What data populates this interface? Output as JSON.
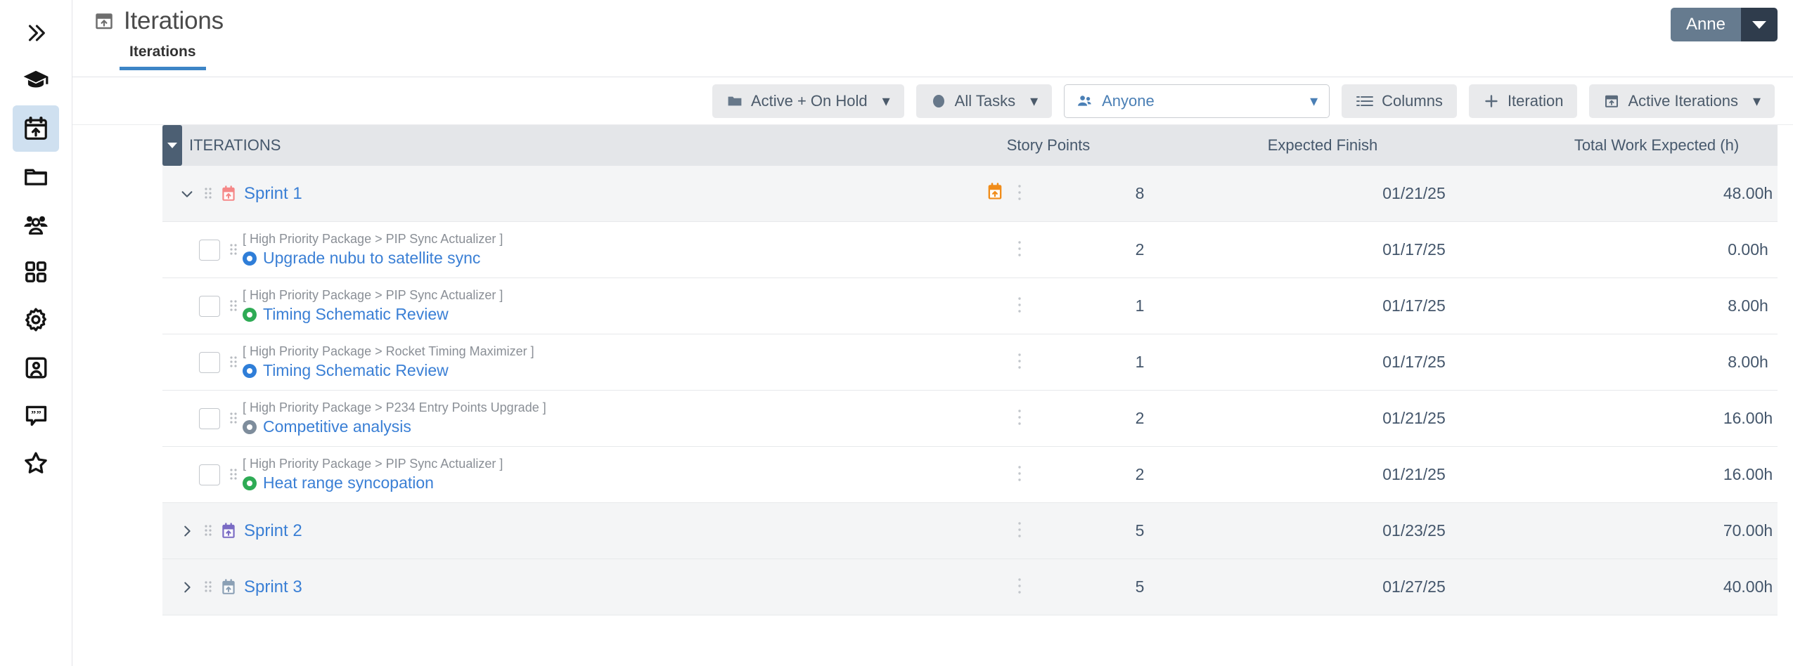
{
  "header": {
    "title": "Iterations",
    "title_icon": "calendar-upload-icon",
    "tabs": [
      {
        "label": "Iterations",
        "active": true
      }
    ],
    "user": {
      "name": "Anne",
      "caret_icon": "caret-down-icon"
    }
  },
  "sidebar": {
    "collapse_icon": "chevrons-right-icon",
    "items": [
      {
        "name": "graduation-cap",
        "icon": "graduation-cap-icon",
        "active": false
      },
      {
        "name": "iterations",
        "icon": "calendar-upload-icon",
        "active": true
      },
      {
        "name": "folder",
        "icon": "folder-icon",
        "active": false
      },
      {
        "name": "people",
        "icon": "people-group-icon",
        "active": false
      },
      {
        "name": "grid",
        "icon": "grid-squares-icon",
        "active": false
      },
      {
        "name": "settings",
        "icon": "gear-icon",
        "active": false
      },
      {
        "name": "contact",
        "icon": "contact-card-icon",
        "active": false
      },
      {
        "name": "feedback",
        "icon": "quote-bubble-icon",
        "active": false
      },
      {
        "name": "favorites",
        "icon": "star-icon",
        "active": false
      }
    ]
  },
  "toolbar": {
    "status_filter": {
      "label": "Active + On Hold",
      "icon": "folder-icon",
      "caret": "▾"
    },
    "task_filter": {
      "label": "All Tasks",
      "icon": "circle-icon",
      "caret": "▾"
    },
    "assignee_filter": {
      "label": "Anyone",
      "icon": "people-icon",
      "caret": "▾"
    },
    "columns_button": {
      "label": "Columns",
      "icon": "columns-list-icon"
    },
    "add_iteration_button": {
      "label": "Iteration",
      "icon": "plus-icon"
    },
    "view_selector": {
      "label": "Active Iterations",
      "icon": "calendar-upload-icon",
      "caret": "▾"
    }
  },
  "table": {
    "columns": {
      "name": "ITERATIONS",
      "story_points": "Story Points",
      "expected_finish": "Expected Finish",
      "total_work": "Total Work Expected (h)"
    },
    "rows": [
      {
        "type": "sprint",
        "name": "Sprint 1",
        "expanded": true,
        "icon_color": "#f58787",
        "mid_icon": "calendar-upload-icon",
        "mid_icon_color": "#f08c1a",
        "story_points": "8",
        "expected_finish": "01/21/25",
        "total_work": "48.00h"
      },
      {
        "type": "task",
        "breadcrumb": "[ High Priority Package > PIP Sync Actualizer ]",
        "name": "Upgrade nubu to satellite sync",
        "status_color": "#2f7ed8",
        "story_points": "2",
        "expected_finish": "01/17/25",
        "total_work": "0.00h"
      },
      {
        "type": "task",
        "breadcrumb": "[ High Priority Package > PIP Sync Actualizer ]",
        "name": "Timing Schematic Review",
        "status_color": "#2eab55",
        "story_points": "1",
        "expected_finish": "01/17/25",
        "total_work": "8.00h"
      },
      {
        "type": "task",
        "breadcrumb": "[ High Priority Package > Rocket Timing Maximizer ]",
        "name": "Timing Schematic Review",
        "status_color": "#2f7ed8",
        "story_points": "1",
        "expected_finish": "01/17/25",
        "total_work": "8.00h"
      },
      {
        "type": "task",
        "breadcrumb": "[ High Priority Package > P234 Entry Points Upgrade ]",
        "name": "Competitive analysis",
        "status_color": "#7e8d9c",
        "story_points": "2",
        "expected_finish": "01/21/25",
        "total_work": "16.00h"
      },
      {
        "type": "task",
        "breadcrumb": "[ High Priority Package > PIP Sync Actualizer ]",
        "name": "Heat range syncopation",
        "status_color": "#2eab55",
        "story_points": "2",
        "expected_finish": "01/21/25",
        "total_work": "16.00h"
      },
      {
        "type": "sprint",
        "name": "Sprint 2",
        "expanded": false,
        "icon_color": "#7a6bc4",
        "story_points": "5",
        "expected_finish": "01/23/25",
        "total_work": "70.00h"
      },
      {
        "type": "sprint",
        "name": "Sprint 3",
        "expanded": false,
        "icon_color": "#8ba0b5",
        "story_points": "5",
        "expected_finish": "01/27/25",
        "total_work": "40.00h"
      }
    ]
  }
}
